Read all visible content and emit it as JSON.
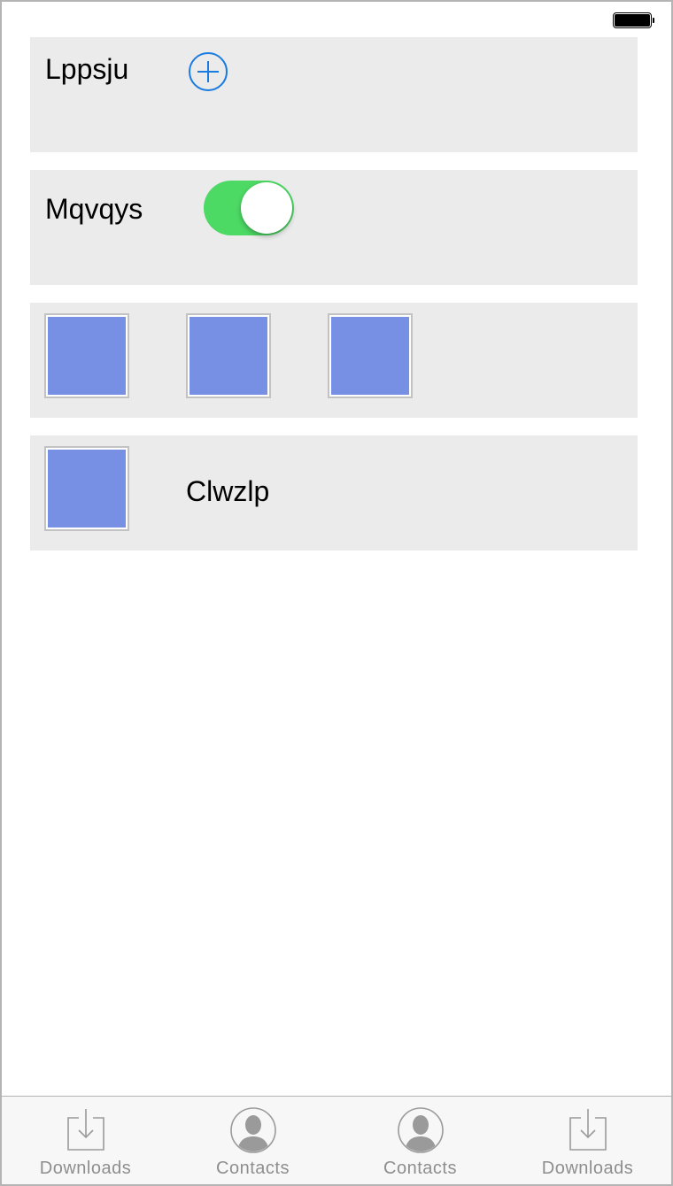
{
  "status_bar": {
    "battery_icon": "battery-full-icon"
  },
  "rows": [
    {
      "label": "Lppsju",
      "control": "add-button",
      "icon": "plus-circle-icon",
      "accent": "#1a7be0"
    },
    {
      "label": "Mqvqys",
      "control": "toggle",
      "toggle_on": true,
      "toggle_color": "#4cd964"
    },
    {
      "thumbnails": 3,
      "thumb_color": "#7890e3"
    },
    {
      "label": "Clwzlp",
      "thumbnails": 1,
      "thumb_color": "#7890e3"
    }
  ],
  "tabbar": {
    "items": [
      {
        "label": "Downloads",
        "icon": "download-icon"
      },
      {
        "label": "Contacts",
        "icon": "contact-icon"
      },
      {
        "label": "Contacts",
        "icon": "contact-icon"
      },
      {
        "label": "Downloads",
        "icon": "download-icon"
      }
    ]
  }
}
